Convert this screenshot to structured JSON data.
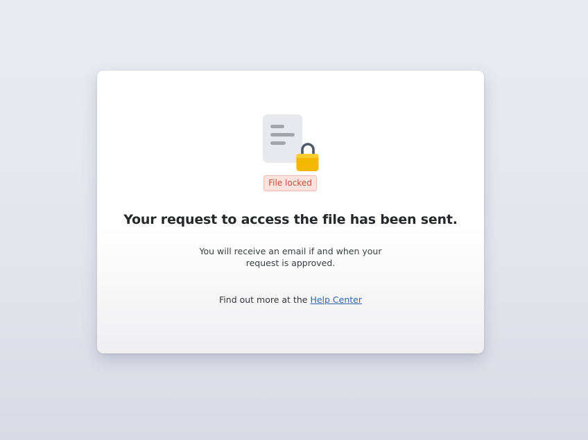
{
  "card": {
    "badge_label": "File locked",
    "title": "Your request to access the file has been sent.",
    "subtitle": "You will receive an email if and when your request is approved.",
    "help_prefix": "Find out more at the",
    "help_link": "Help Center"
  },
  "icons": {
    "document": "document-icon",
    "lock": "padlock-icon"
  },
  "colors": {
    "badge_background": "#fde3de",
    "badge_text": "#c54a3c",
    "link": "#2a63b4",
    "lock": "#f5b800"
  }
}
